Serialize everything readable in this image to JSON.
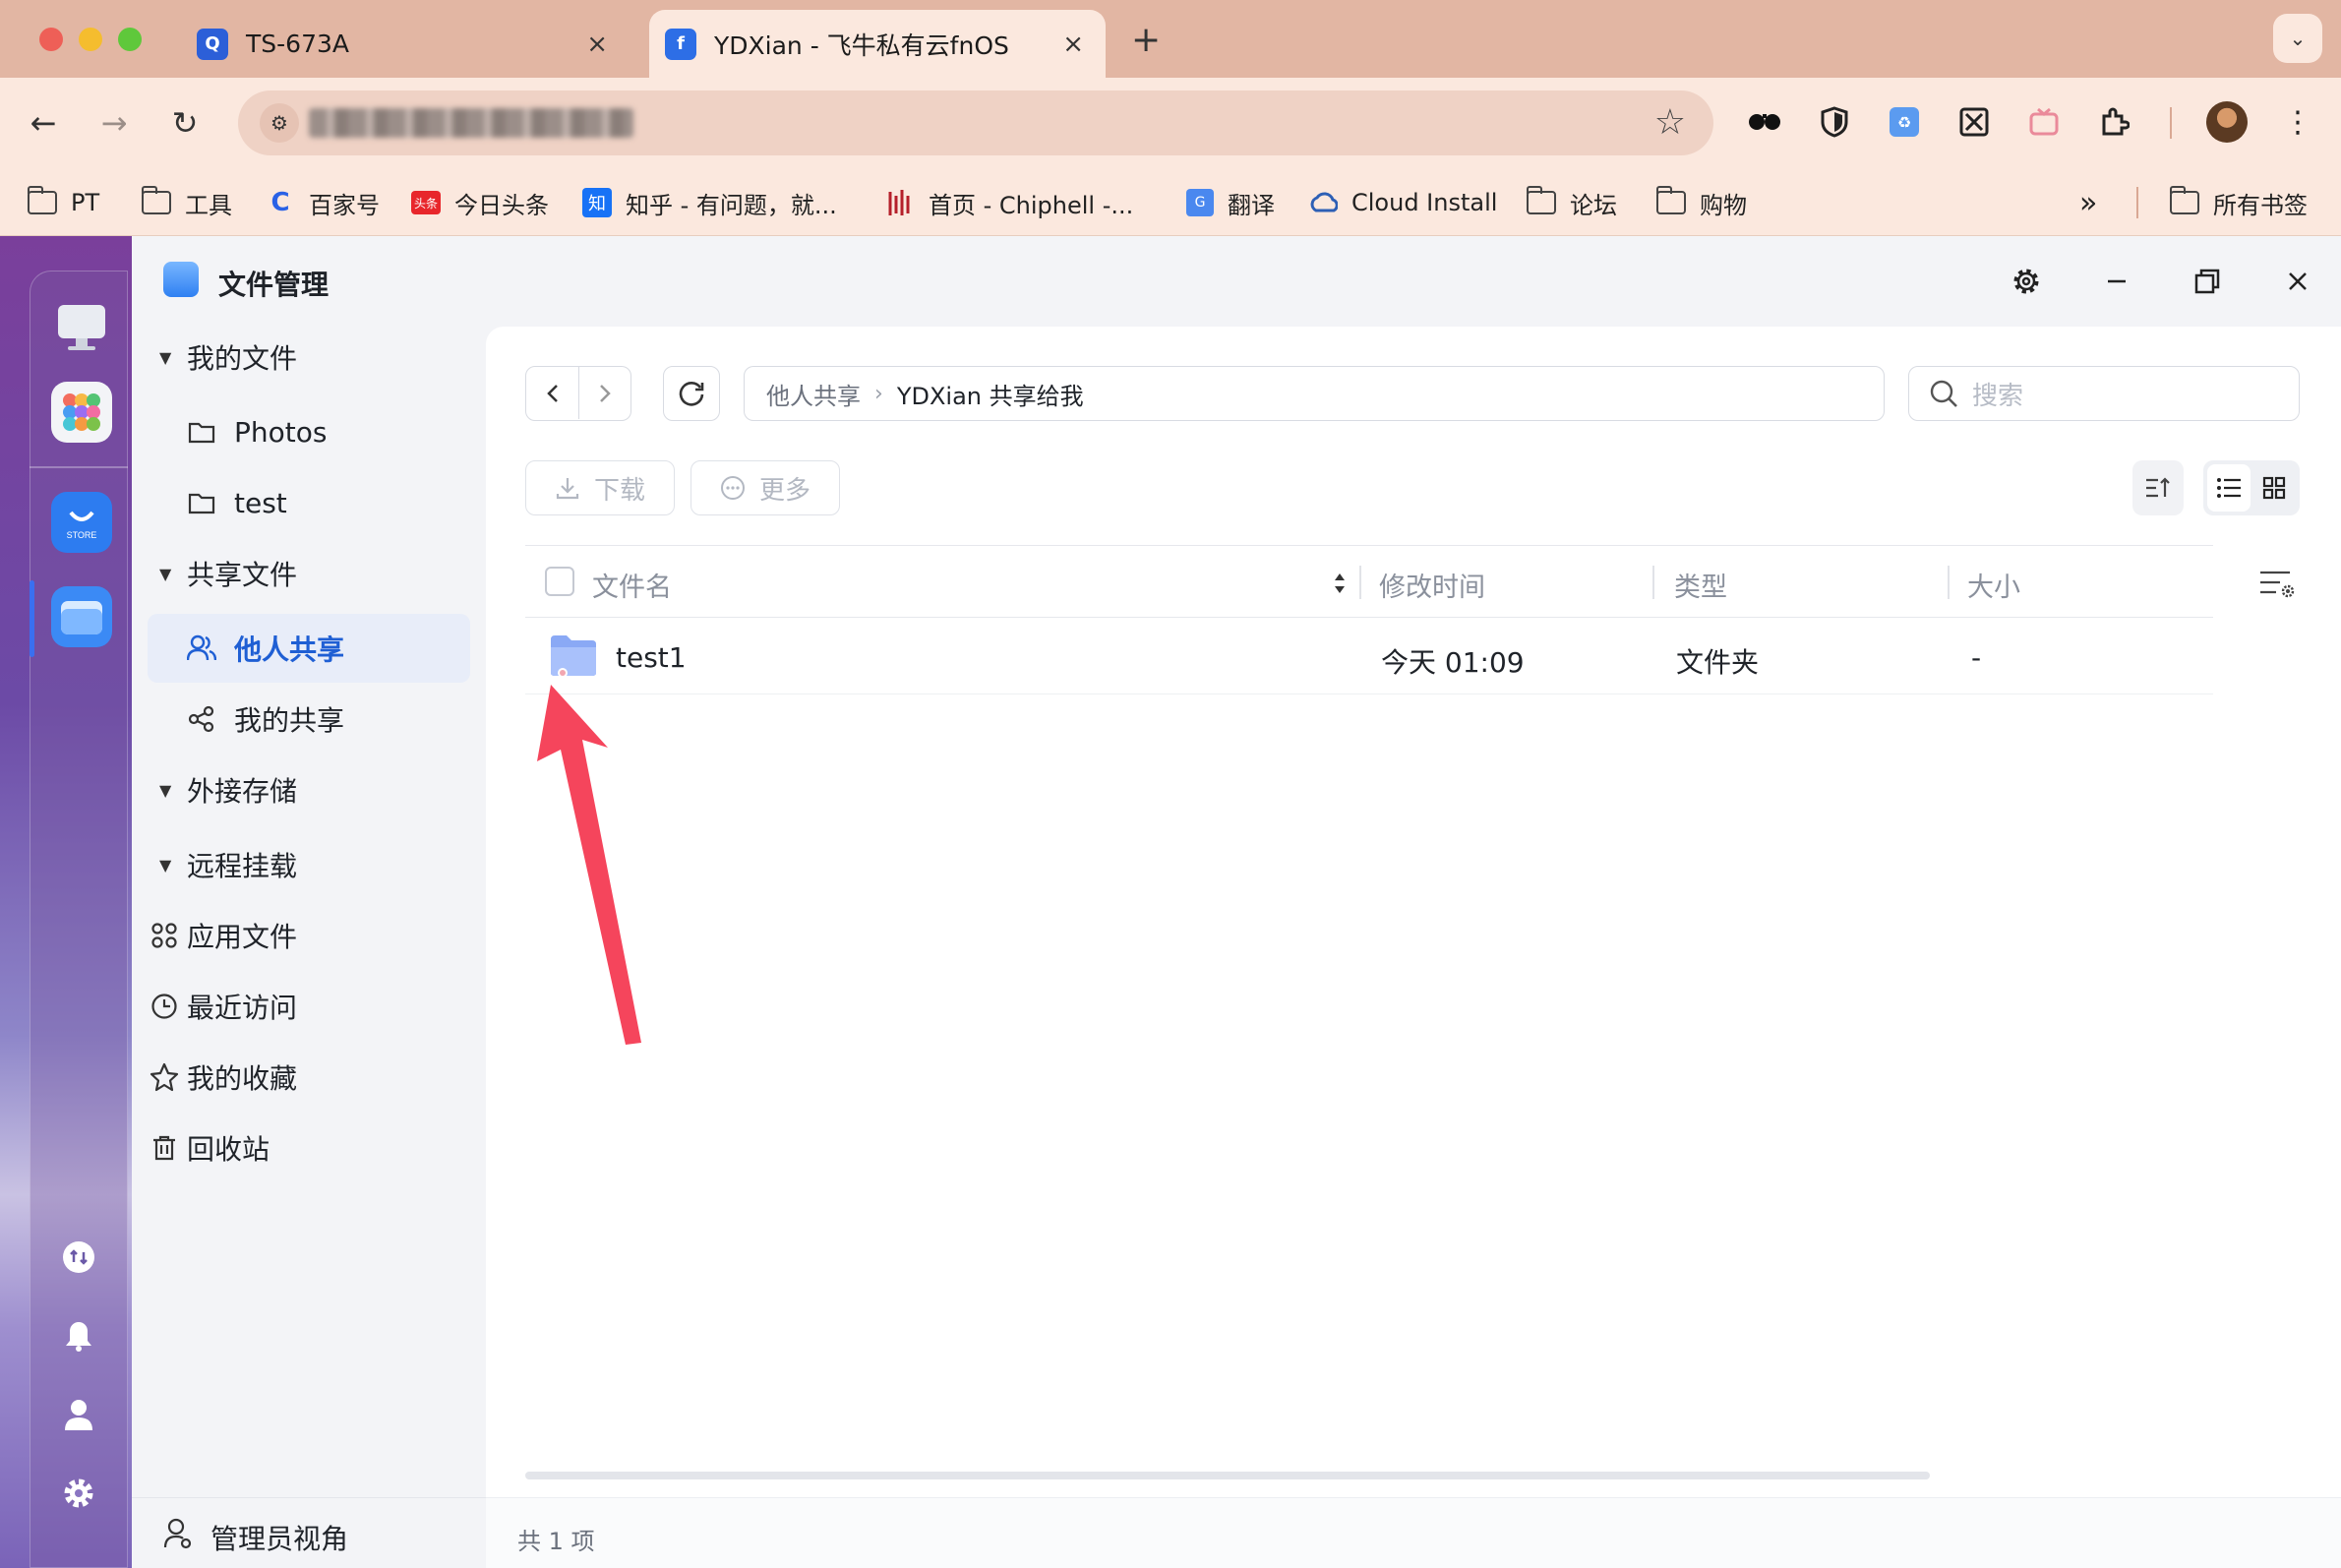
{
  "browser": {
    "tabs": [
      {
        "label": "TS-673A",
        "active": false
      },
      {
        "label": "YDXian - 飞牛私有云fnOS",
        "active": true
      }
    ],
    "new_tab": "+",
    "close": "×",
    "bookmarks": [
      {
        "label": "PT",
        "icon": "folder-icon"
      },
      {
        "label": "工具",
        "icon": "folder-icon"
      },
      {
        "label": "百家号",
        "icon": "baijiahao-icon"
      },
      {
        "label": "今日头条",
        "icon": "toutiao-icon"
      },
      {
        "label": "知乎 - 有问题，就...",
        "icon": "zhihu-icon"
      },
      {
        "label": "首页 - Chiphell -...",
        "icon": "chiphell-icon"
      },
      {
        "label": "翻译",
        "icon": "translate-icon"
      },
      {
        "label": "Cloud Install",
        "icon": "cloud-icon"
      },
      {
        "label": "论坛",
        "icon": "folder-icon"
      },
      {
        "label": "购物",
        "icon": "folder-icon"
      }
    ],
    "bookmarks_overflow": "»",
    "all_bookmarks": "所有书签",
    "toutiao_badge": "头条",
    "zhihu_badge": "知"
  },
  "window": {
    "title": "文件管理"
  },
  "sidebar": {
    "groups": [
      {
        "label": "我的文件",
        "expanded": true
      },
      {
        "label": "Photos"
      },
      {
        "label": "test"
      },
      {
        "label": "共享文件",
        "expanded": true
      },
      {
        "label": "他人共享",
        "selected": true
      },
      {
        "label": "我的共享"
      },
      {
        "label": "外接存储"
      },
      {
        "label": "远程挂载"
      },
      {
        "label": "应用文件"
      },
      {
        "label": "最近访问"
      },
      {
        "label": "我的收藏"
      },
      {
        "label": "回收站"
      }
    ],
    "admin_view": "管理员视角"
  },
  "toolbar": {
    "breadcrumb": [
      "他人共享",
      "YDXian 共享给我"
    ],
    "search_placeholder": "搜索",
    "download": "下载",
    "more": "更多"
  },
  "table": {
    "columns": [
      "文件名",
      "修改时间",
      "类型",
      "大小"
    ],
    "rows": [
      {
        "name": "test1",
        "modified": "今天 01:09",
        "type": "文件夹",
        "size": "-"
      }
    ]
  },
  "status": {
    "count": "共 1 项"
  },
  "colors": {
    "accent": "#1f5fd4",
    "tabbar": "#e2b6a3",
    "toolbar": "#fbe8de",
    "annotation_arrow": "#f5455c"
  }
}
